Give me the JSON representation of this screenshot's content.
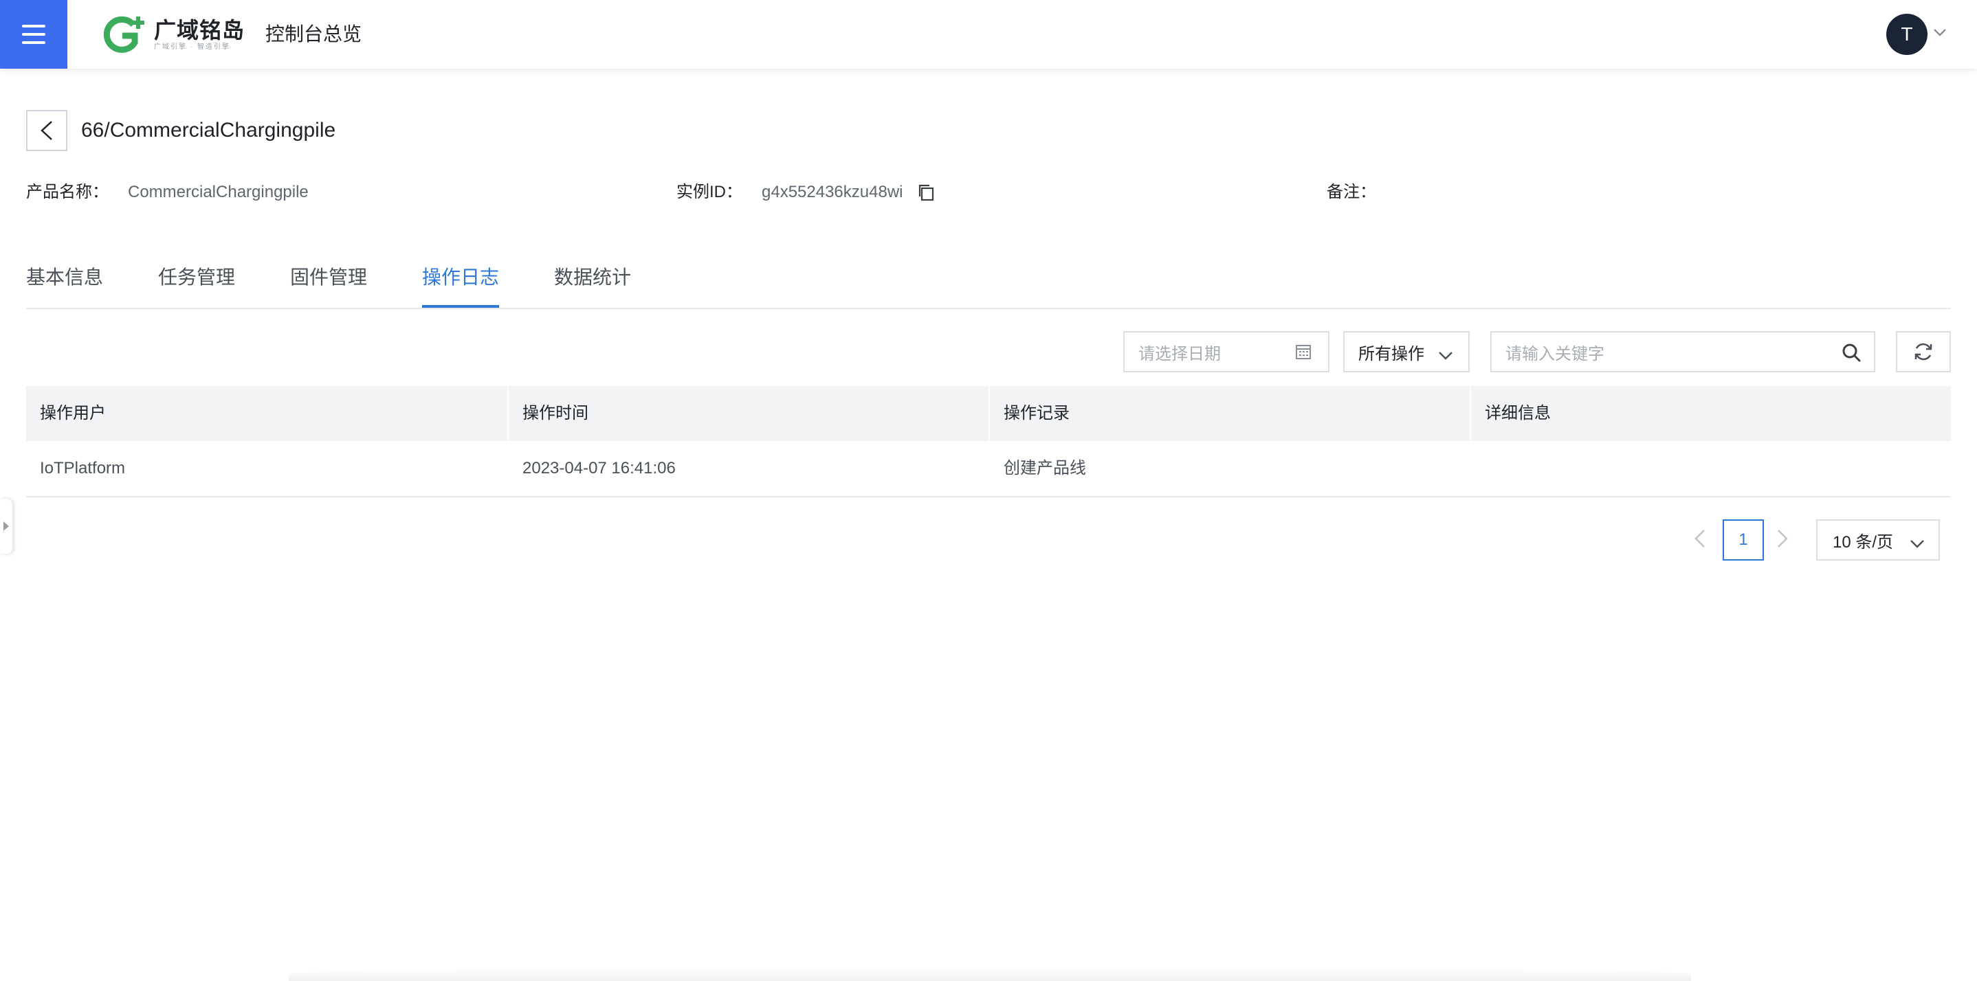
{
  "topbar": {
    "brand_name": "广域铭岛",
    "brand_slogan": "广域引擎 · 智造引擎",
    "console_title": "控制台总览",
    "user_initial": "T",
    "brand_color": "#3b6cf0"
  },
  "header": {
    "title": "66/CommercialChargingpile",
    "product_name_label": "产品名称：",
    "product_name_value": "CommercialChargingpile",
    "instance_id_label": "实例ID：",
    "instance_id_value": "g4x552436kzu48wi",
    "remark_label": "备注：",
    "remark_value": ""
  },
  "tabs": [
    {
      "label": "基本信息",
      "active": false
    },
    {
      "label": "任务管理",
      "active": false
    },
    {
      "label": "固件管理",
      "active": false
    },
    {
      "label": "操作日志",
      "active": true
    },
    {
      "label": "数据统计",
      "active": false
    }
  ],
  "toolbar": {
    "date_placeholder": "请选择日期",
    "operation_filter": "所有操作",
    "search_placeholder": "请输入关键字"
  },
  "table": {
    "columns": [
      "操作用户",
      "操作时间",
      "操作记录",
      "详细信息"
    ],
    "rows": [
      [
        "IoTPlatform",
        "2023-04-07 16:41:06",
        "创建产品线",
        ""
      ]
    ]
  },
  "pagination": {
    "current_page": "1",
    "page_size": "10 条/页"
  },
  "colors": {
    "accent": "#2e78d8",
    "menu_bg": "#3b6cf0",
    "logo_green": "#3dab5c"
  }
}
